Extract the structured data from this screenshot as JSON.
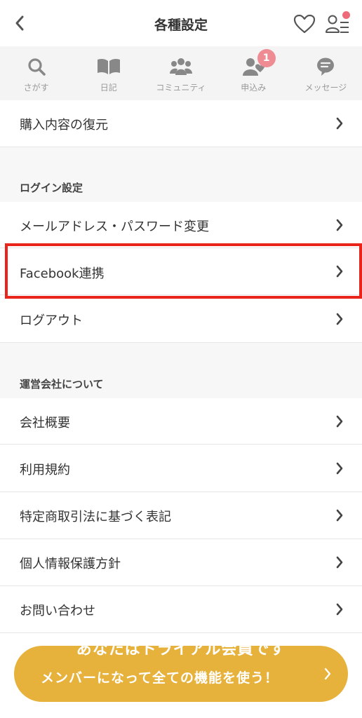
{
  "header": {
    "title": "各種設定",
    "back_icon": "chevron-left-icon",
    "favorite_icon": "heart-icon",
    "profile_icon": "profile-list-icon",
    "notification_dot_color": "#ef6a78"
  },
  "tabs": [
    {
      "label": "さがす",
      "icon": "search-icon"
    },
    {
      "label": "日記",
      "icon": "book-icon"
    },
    {
      "label": "コミュニティ",
      "icon": "community-icon"
    },
    {
      "label": "申込み",
      "icon": "person-heart-icon",
      "badge": "1"
    },
    {
      "label": "メッセージ",
      "icon": "message-icon"
    }
  ],
  "items": {
    "restore_purchase": "購入内容の復元",
    "login_section": "ログイン設定",
    "email_password": "メールアドレス・パスワード変更",
    "facebook": "Facebook連携",
    "logout": "ログアウト",
    "company_section": "運営会社について",
    "company_overview": "会社概要",
    "terms": "利用規約",
    "commerce_law": "特定商取引法に基づく表記",
    "privacy": "個人情報保護方針",
    "contact": "お問い合わせ"
  },
  "banner": {
    "line1": "あなたはトライアル会員です",
    "line2": "メンバーになって全ての機能を使う！",
    "color": "#e7b23b"
  },
  "colors": {
    "highlight": "#e8241b",
    "badge": "#ef8c93"
  }
}
